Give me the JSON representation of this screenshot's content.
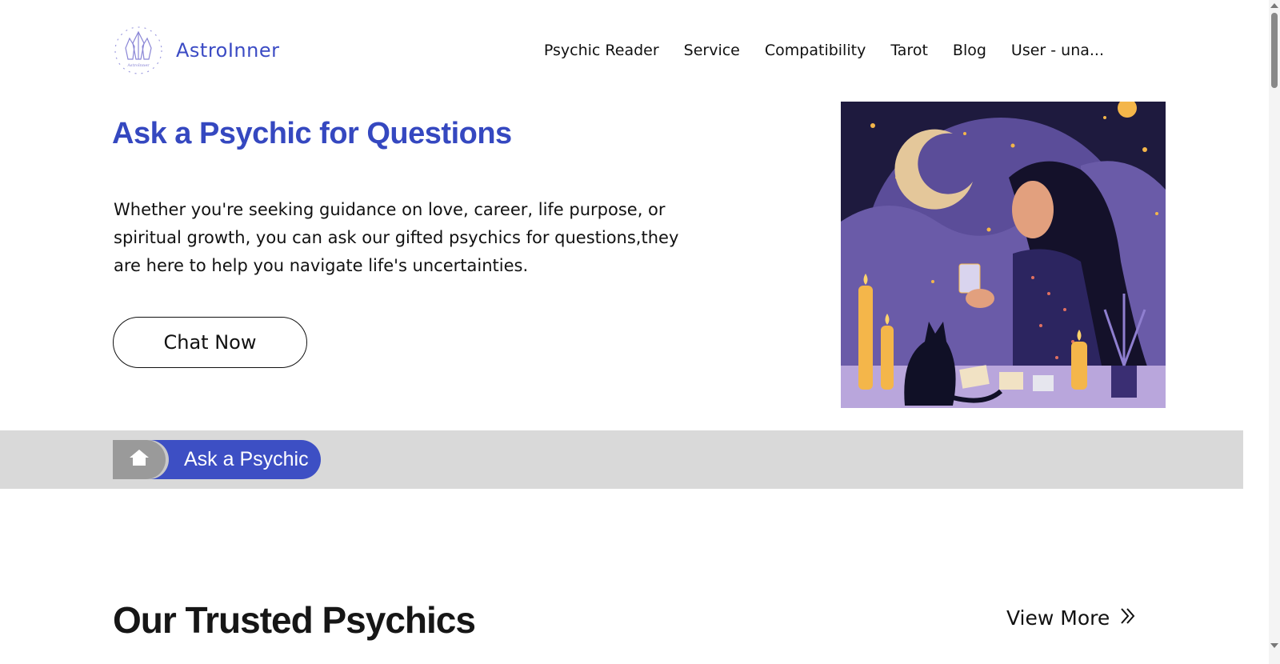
{
  "brand": {
    "name": "AstroInner",
    "logo_small_text": "AstroInner"
  },
  "nav": {
    "items": [
      {
        "label": "Psychic Reader"
      },
      {
        "label": "Service"
      },
      {
        "label": "Compatibility"
      },
      {
        "label": "Tarot"
      },
      {
        "label": "Blog"
      },
      {
        "label": "User - una..."
      }
    ]
  },
  "hero": {
    "title": "Ask a Psychic for Questions",
    "description": "Whether you're seeking guidance on love, career, life purpose, or spiritual growth, you can ask our gifted psychics for questions,they are here to help you navigate life's uncertainties.",
    "cta_label": "Chat Now",
    "image_icon": "psychic-woman-illustration"
  },
  "breadcrumb": {
    "home_icon": "home-icon",
    "current": "Ask a Psychic"
  },
  "section": {
    "title": "Our Trusted Psychics",
    "view_more": "View More"
  },
  "colors": {
    "accent": "#3d4fc4",
    "band": "#d9d9d9",
    "illustration_bg": "#5b4d99"
  }
}
